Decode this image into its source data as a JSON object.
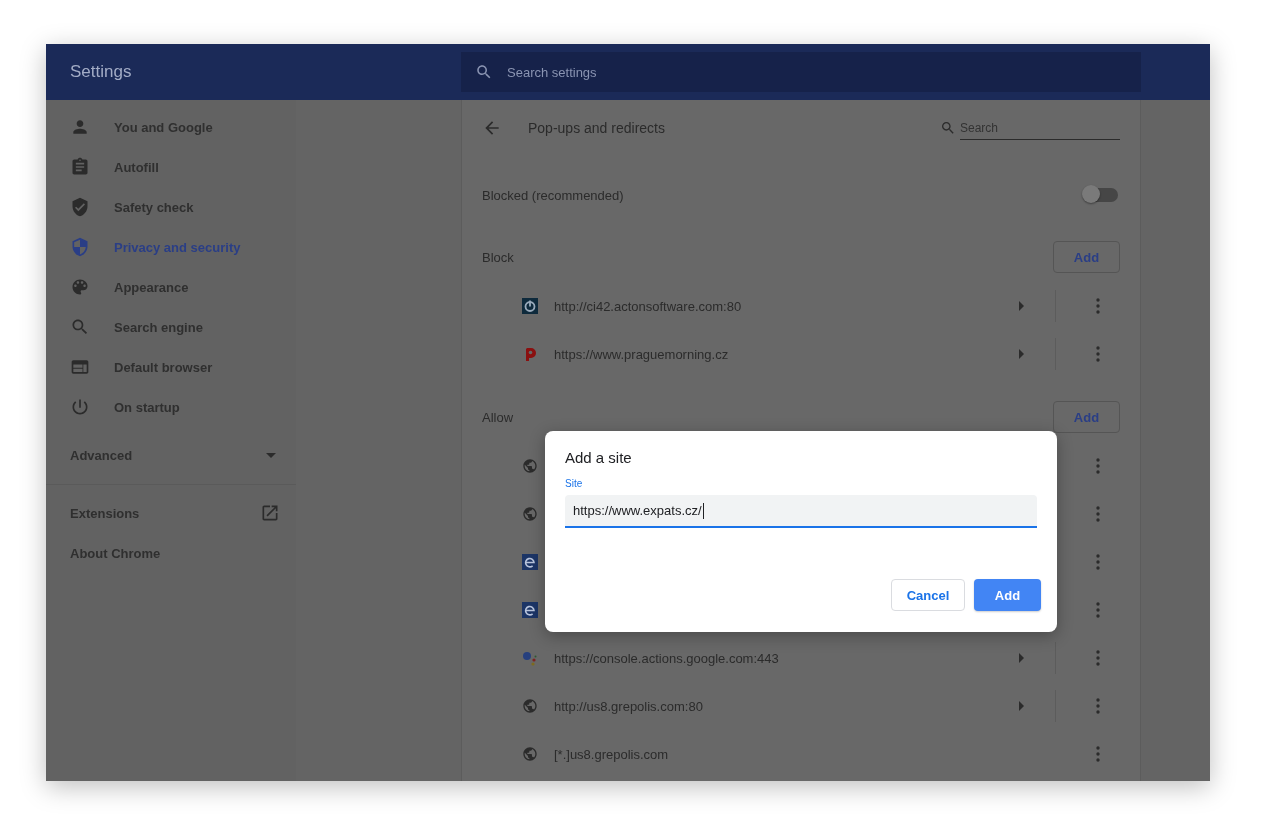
{
  "header": {
    "title": "Settings",
    "search": {
      "placeholder": "Search settings"
    }
  },
  "sidebar": {
    "items": [
      {
        "kind": "person",
        "label": "You and Google",
        "selected": false
      },
      {
        "kind": "clipboard",
        "label": "Autofill",
        "selected": false
      },
      {
        "kind": "shield-check",
        "label": "Safety check",
        "selected": false
      },
      {
        "kind": "shield-half",
        "label": "Privacy and security",
        "selected": true
      },
      {
        "kind": "palette",
        "label": "Appearance",
        "selected": false
      },
      {
        "kind": "search",
        "label": "Search engine",
        "selected": false
      },
      {
        "kind": "browser",
        "label": "Default browser",
        "selected": false
      },
      {
        "kind": "power",
        "label": "On startup",
        "selected": false
      }
    ],
    "advanced": {
      "label": "Advanced",
      "expanded": false
    },
    "links": [
      {
        "label": "Extensions",
        "external": true
      },
      {
        "label": "About Chrome",
        "external": false
      }
    ]
  },
  "page": {
    "title": "Pop-ups and redirects",
    "search": {
      "placeholder": "Search"
    },
    "toggle": {
      "label": "Blocked (recommended)",
      "on": false
    },
    "sections": [
      {
        "heading": "Block",
        "button": "Add",
        "sites": [
          {
            "kind": "power-square",
            "url": "http://ci42.actonsoftware.com:80",
            "arrow": true
          },
          {
            "kind": "p-logo",
            "url": "https://www.praguemorning.cz",
            "arrow": true
          }
        ]
      },
      {
        "heading": "Allow",
        "button": "Add",
        "sites": [
          {
            "kind": "globe"
          },
          {
            "kind": "globe"
          },
          {
            "kind": "e-square"
          },
          {
            "kind": "e-square"
          },
          {
            "kind": "dots",
            "url": "https://console.actions.google.com:443",
            "arrow": true
          },
          {
            "kind": "globe",
            "url": "http://us8.grepolis.com:80",
            "arrow": true
          },
          {
            "kind": "globe",
            "url": "[*.]us8.grepolis.com",
            "arrow": false
          }
        ]
      }
    ]
  },
  "dialog": {
    "title": "Add a site",
    "field": {
      "label": "Site",
      "value": "https://www.expats.cz/",
      "focused": true
    },
    "buttons": [
      {
        "label": "Cancel",
        "kind": "secondary"
      },
      {
        "label": "Add",
        "kind": "primary"
      }
    ]
  }
}
